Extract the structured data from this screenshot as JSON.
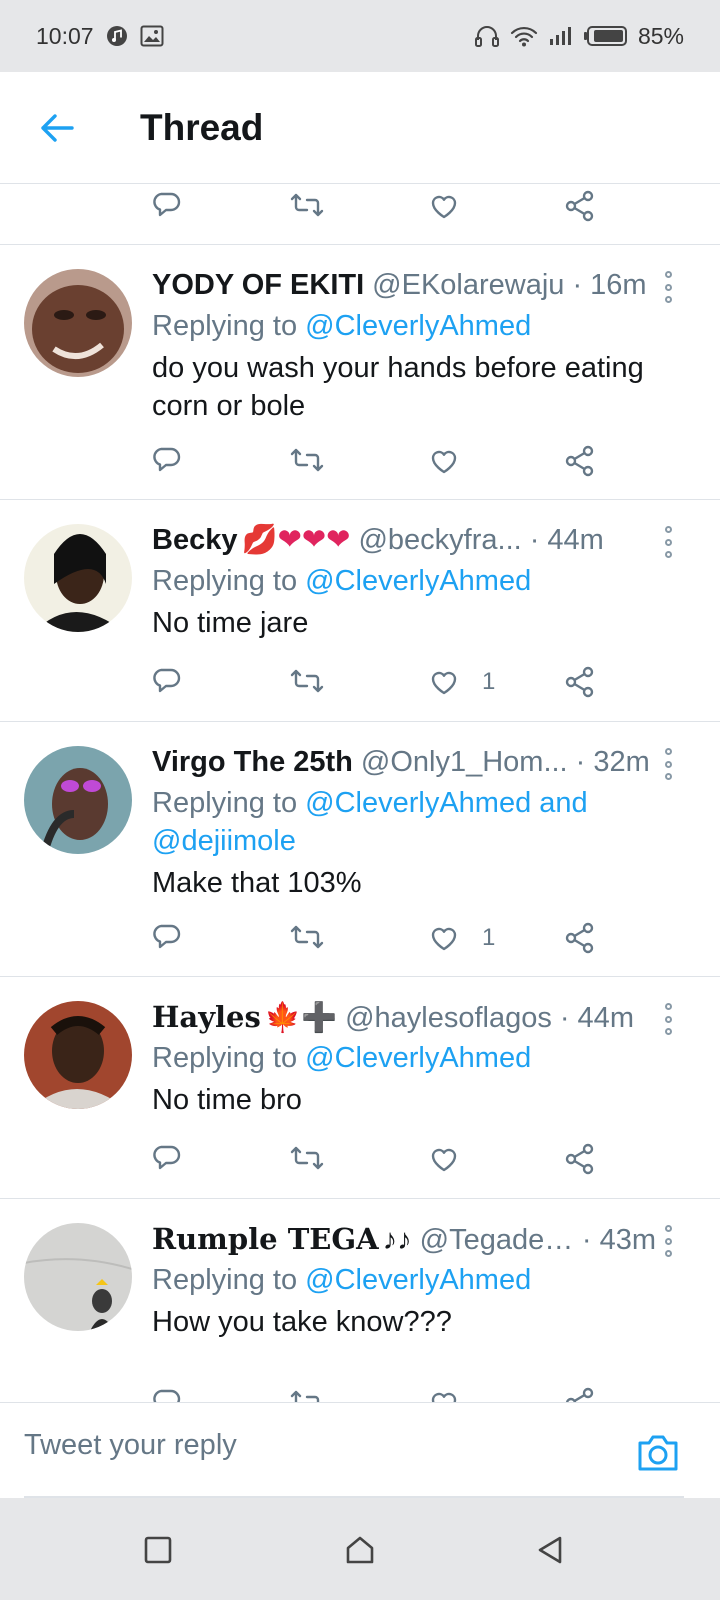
{
  "status_bar": {
    "time": "10:07",
    "battery": "85%"
  },
  "header": {
    "title": "Thread"
  },
  "tweets": [
    {
      "name": "YODY OF EKITI",
      "emoji": "",
      "handle": "@EKolarewaju",
      "time": "· 16m",
      "replying_prefix": "Replying to",
      "replying_to": "@CleverlyAhmed",
      "replying_and": "",
      "replying_to_2": "",
      "text": "do you wash your hands before eating corn or bole",
      "likes": ""
    },
    {
      "name": "Becky",
      "emoji": "💋❤❤❤",
      "handle": "@beckyfra...",
      "time": "· 44m",
      "replying_prefix": "Replying to",
      "replying_to": "@CleverlyAhmed",
      "replying_and": "",
      "replying_to_2": "",
      "text": "No time jare",
      "likes": "1"
    },
    {
      "name": "Virgo The 25th",
      "emoji": "",
      "handle": "@Only1_Hom...",
      "time": "· 32m",
      "replying_prefix": "Replying to",
      "replying_to": "@CleverlyAhmed",
      "replying_and": "and",
      "replying_to_2": "@dejiimole",
      "text": "Make that 103%",
      "likes": "1"
    },
    {
      "name": "Hayles",
      "emoji": "🍁➕",
      "handle": "@haylesoflagos",
      "time": "· 44m",
      "replying_prefix": "Replying to",
      "replying_to": "@CleverlyAhmed",
      "replying_and": "",
      "replying_to_2": "",
      "text": "No time bro",
      "likes": ""
    },
    {
      "name": "Rumple TEGA",
      "emoji": "♪♪",
      "handle": "@Tegadeyf...",
      "time": "· 43m",
      "replying_prefix": "Replying to",
      "replying_to": "@CleverlyAhmed",
      "replying_and": "",
      "replying_to_2": "",
      "text": "How you take know???",
      "likes": ""
    }
  ],
  "composer": {
    "placeholder": "Tweet your reply"
  },
  "colors": {
    "accent": "#1da1f2",
    "text": "#14171a",
    "secondary": "#657786",
    "divider": "#dfe3e8"
  },
  "icons": [
    "back-arrow-icon",
    "reply-icon",
    "retweet-icon",
    "like-icon",
    "share-icon",
    "more-icon",
    "camera-icon",
    "recents-icon",
    "home-icon",
    "back-icon"
  ]
}
